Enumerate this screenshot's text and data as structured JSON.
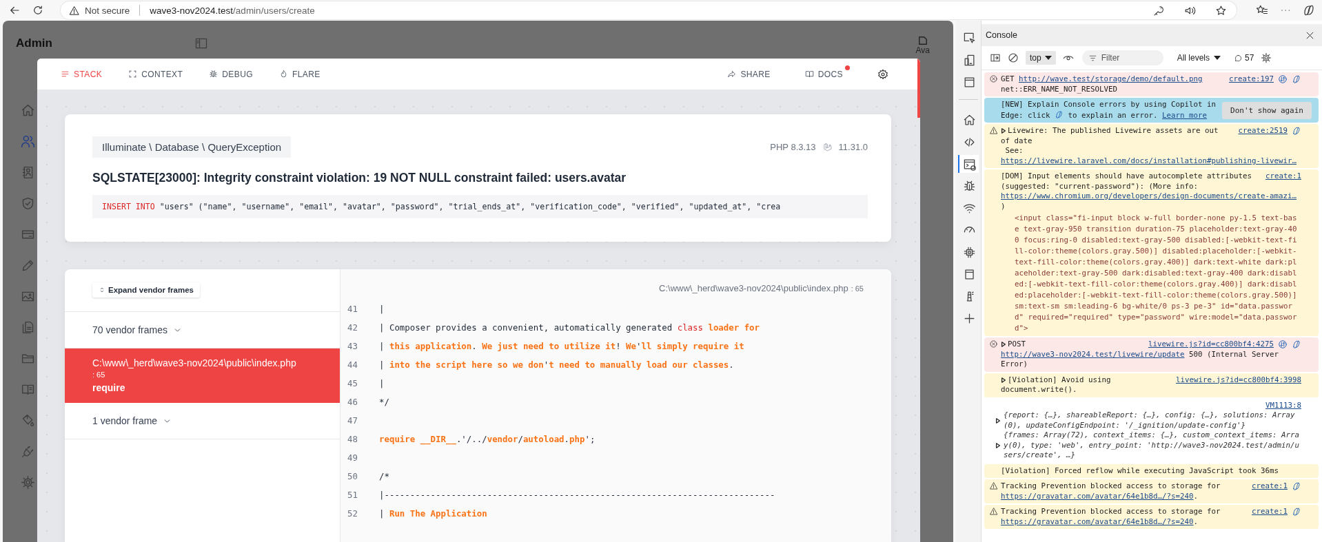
{
  "browser": {
    "security": "Not secure",
    "url_host": "wave3-nov2024.test",
    "url_path": "/admin/users/create"
  },
  "admin": {
    "title": "Admin",
    "avatar_alt": "Ava",
    "sidebar": [
      {
        "selected": false
      },
      {
        "selected": true
      },
      {
        "selected": false
      },
      {
        "selected": false
      },
      {
        "selected": false
      },
      {
        "selected": false
      },
      {
        "selected": false
      },
      {
        "selected": false
      },
      {
        "selected": false
      },
      {
        "selected": false
      },
      {
        "selected": false
      },
      {
        "selected": false
      },
      {
        "selected": false
      }
    ]
  },
  "ignition": {
    "tabs": [
      {
        "label": "STACK",
        "selected": true
      },
      {
        "label": "CONTEXT",
        "selected": false
      },
      {
        "label": "DEBUG",
        "selected": false
      },
      {
        "label": "FLARE",
        "selected": false
      }
    ],
    "actions": [
      {
        "label": "SHARE",
        "notification": false
      },
      {
        "label": "DOCS",
        "notification": true
      }
    ],
    "exception": {
      "class": "Illuminate \\ Database \\ QueryException",
      "php_version": "PHP 8.3.13",
      "laravel_version": "11.31.0",
      "message": "SQLSTATE[23000]: Integrity constraint violation: 19 NOT NULL constraint failed: users.avatar",
      "sql": [
        {
          "kind": "keyword",
          "text": "INSERT INTO"
        },
        {
          "kind": "plain",
          "text": " \"users\" (\"name\", \"username\", \"email\", \"avatar\", \"password\", \"trial_ends_at\", \"verification_code\", \"verified\", \"updated_at\", \"crea"
        }
      ]
    },
    "stack": {
      "expand_button": "Expand vendor frames",
      "frames": [
        {
          "kind": "vendor-group",
          "label": "70 vendor frames",
          "selected": false
        },
        {
          "kind": "frame",
          "file": "C:\\www\\_herd\\wave3-nov2024\\public\\index.php",
          "line": ": 65",
          "method": "require",
          "selected": true
        },
        {
          "kind": "vendor-group",
          "label": "1 vendor frame",
          "selected": false
        }
      ],
      "file_path": "C:\\www\\_herd\\wave3-nov2024\\public\\index.php",
      "line": ": 65",
      "code": [
        {
          "number": "41",
          "tokens": [
            {
              "kind": "plain",
              "text": "|"
            }
          ]
        },
        {
          "number": "42",
          "tokens": [
            {
              "kind": "plain",
              "text": "| Composer provides a convenient, automatically generated "
            },
            {
              "kind": "keyword",
              "text": "class"
            },
            {
              "kind": "accent",
              "text": " loader for"
            }
          ]
        },
        {
          "number": "43",
          "tokens": [
            {
              "kind": "plain",
              "text": "| "
            },
            {
              "kind": "accent",
              "text": "this application"
            },
            {
              "kind": "plain",
              "text": ". "
            },
            {
              "kind": "accent",
              "text": "We just need to utilize it"
            },
            {
              "kind": "plain",
              "text": "! "
            },
            {
              "kind": "accent",
              "text": "We"
            },
            {
              "kind": "plain",
              "text": "'"
            },
            {
              "kind": "accent",
              "text": "ll simply require it"
            }
          ]
        },
        {
          "number": "44",
          "tokens": [
            {
              "kind": "plain",
              "text": "| "
            },
            {
              "kind": "accent",
              "text": "into the script here so we don"
            },
            {
              "kind": "plain",
              "text": "'"
            },
            {
              "kind": "accent",
              "text": "t need to manually load our classes"
            },
            {
              "kind": "plain",
              "text": "."
            }
          ]
        },
        {
          "number": "45",
          "tokens": [
            {
              "kind": "plain",
              "text": "|"
            }
          ]
        },
        {
          "number": "46",
          "tokens": [
            {
              "kind": "plain",
              "text": "*/"
            }
          ]
        },
        {
          "number": "47"
        },
        {
          "number": "48",
          "tokens": [
            {
              "kind": "accent",
              "text": "require __DIR__"
            },
            {
              "kind": "plain",
              "text": ".'/../"
            },
            {
              "kind": "accent",
              "text": "vendor"
            },
            {
              "kind": "plain",
              "text": "/"
            },
            {
              "kind": "accent",
              "text": "autoload"
            },
            {
              "kind": "plain",
              "text": "."
            },
            {
              "kind": "accent",
              "text": "php"
            },
            {
              "kind": "plain",
              "text": "';"
            }
          ]
        },
        {
          "number": "49"
        },
        {
          "number": "50",
          "tokens": [
            {
              "kind": "plain",
              "text": "/*"
            }
          ]
        },
        {
          "number": "51",
          "tokens": [
            {
              "kind": "plain",
              "text": "|----------------------------------------------------------------------------"
            }
          ]
        },
        {
          "number": "52",
          "tokens": [
            {
              "kind": "plain",
              "text": "| "
            },
            {
              "kind": "accent",
              "text": "Run The Application"
            }
          ]
        }
      ]
    }
  },
  "devtools": {
    "tools": [
      {
        "selected": false
      },
      {
        "selected": false
      },
      {
        "selected": false
      },
      {
        "selected": false
      },
      {
        "selected": false
      },
      {
        "selected": true
      },
      {
        "selected": false
      },
      {
        "selected": false
      },
      {
        "selected": false
      },
      {
        "selected": false
      },
      {
        "selected": false
      },
      {
        "selected": false
      },
      {
        "selected": false
      }
    ],
    "panel_title": "Console",
    "context": "top",
    "filter_placeholder": "Filter",
    "levels": "All levels",
    "message_count": "57",
    "messages": [
      {
        "kind": "error",
        "expandable": false,
        "source": "create:197",
        "first_line": [
          {
            "kind": "text",
            "text": "GET "
          },
          {
            "kind": "link",
            "text": "http://wave.test/storage/demo/default.png"
          }
        ],
        "parts": [
          {
            "kind": "text",
            "text": "net::ERR_NAME_NOT_RESOLVED"
          }
        ]
      },
      {
        "kind": "info",
        "expandable": false,
        "button": "Don't show again",
        "parts": [
          {
            "kind": "text",
            "text": "[NEW] Explain Console errors by using Copilot in Edge: click "
          },
          {
            "kind": "icon"
          },
          {
            "kind": "text",
            "text": " to explain an error. "
          },
          {
            "kind": "link",
            "text": "Learn more"
          }
        ]
      },
      {
        "kind": "warning",
        "expandable": true,
        "source": "create:2519",
        "first_line": [
          {
            "kind": "text",
            "text": "Livewire: The published Livewire assets are out"
          }
        ],
        "parts": [
          {
            "kind": "text",
            "text": "of date\n See:\n"
          },
          {
            "kind": "link",
            "text": "https://livewire.laravel.com/docs/installation#publishing-livewir…"
          }
        ]
      },
      {
        "kind": "verbose",
        "expandable": false,
        "source": "create:1",
        "first_line": [
          {
            "kind": "text",
            "text": "[DOM] Input elements should have autocomplete attributes"
          }
        ],
        "parts": [
          {
            "kind": "text",
            "text": "(suggested: \"current-password\"): (More info: "
          },
          {
            "kind": "link",
            "text": "https://www.chromium.org/developers/design-documents/create-amazi…"
          },
          {
            "kind": "text",
            "text": "\n)"
          }
        ],
        "snippet": "<input class=\"fi-input block w-full border-none py-1.5 text-base text-gray-950 transition duration-75 placeholder:text-gray-400 focus:ring-0 disabled:text-gray-500 disabled:[-webkit-text-fill-color:theme(colors.gray.500)] disabled:placeholder:[-webkit-text-fill-color:theme(colors.gray.400)] dark:text-white dark:placeholder:text-gray-500 dark:disabled:text-gray-400 dark:disabled:[-webkit-text-fill-color:theme(colors.gray.400)] dark:disabled:placeholder:[-webkit-text-fill-color:theme(colors.gray.500)] sm:text-sm sm:leading-6 bg-white/0 ps-3 pe-3\" id=\"data.password\" required=\"required\" type=\"password\" wire:model=\"data.password\">"
      },
      {
        "kind": "error",
        "expandable": true,
        "source": "livewire.js?id=cc800bf4:4275",
        "first_line": [
          {
            "kind": "text",
            "text": "POST"
          }
        ],
        "parts": [
          {
            "kind": "link",
            "text": "http://wave3-nov2024.test/livewire/update"
          },
          {
            "kind": "text",
            "text": " 500 (Internal Server Error)"
          }
        ]
      },
      {
        "kind": "verbose",
        "expandable": true,
        "source": "livewire.js?id=cc800bf4:3998",
        "first_line": [
          {
            "kind": "text",
            "text": "[Violation] Avoid using"
          }
        ],
        "parts": [
          {
            "kind": "text",
            "text": "document.write()."
          }
        ]
      },
      {
        "kind": "log",
        "expandable": false,
        "source": "VM1113:8",
        "objects": [
          "{report: {…}, shareableReport: {…}, config: {…}, solutions: Array(0), updateConfigEndpoint: '/_ignition/update-config'}",
          "{frames: Array(72), context_items: {…}, custom_context_items: Array(0), type: 'web', entry_point: 'http://wave3-nov2024.test/admin/users/create', …}"
        ]
      },
      {
        "kind": "verbose",
        "expandable": false,
        "parts": [
          {
            "kind": "text",
            "text": "[Violation] Forced reflow while executing JavaScript took 36ms"
          }
        ]
      },
      {
        "kind": "warning",
        "expandable": false,
        "source": "create:1",
        "first_line": [
          {
            "kind": "text",
            "text": "Tracking Prevention blocked access to storage for"
          }
        ],
        "parts": [
          {
            "kind": "link",
            "text": "https://gravatar.com/avatar/64e1b8d…/?s=240"
          },
          {
            "kind": "text",
            "text": "."
          }
        ]
      },
      {
        "kind": "warning",
        "expandable": false,
        "source": "create:1",
        "first_line": [
          {
            "kind": "text",
            "text": "Tracking Prevention blocked access to storage for"
          }
        ],
        "parts": [
          {
            "kind": "link",
            "text": "https://gravatar.com/avatar/64e1b8d…/?s=240"
          },
          {
            "kind": "text",
            "text": "."
          }
        ]
      }
    ]
  }
}
